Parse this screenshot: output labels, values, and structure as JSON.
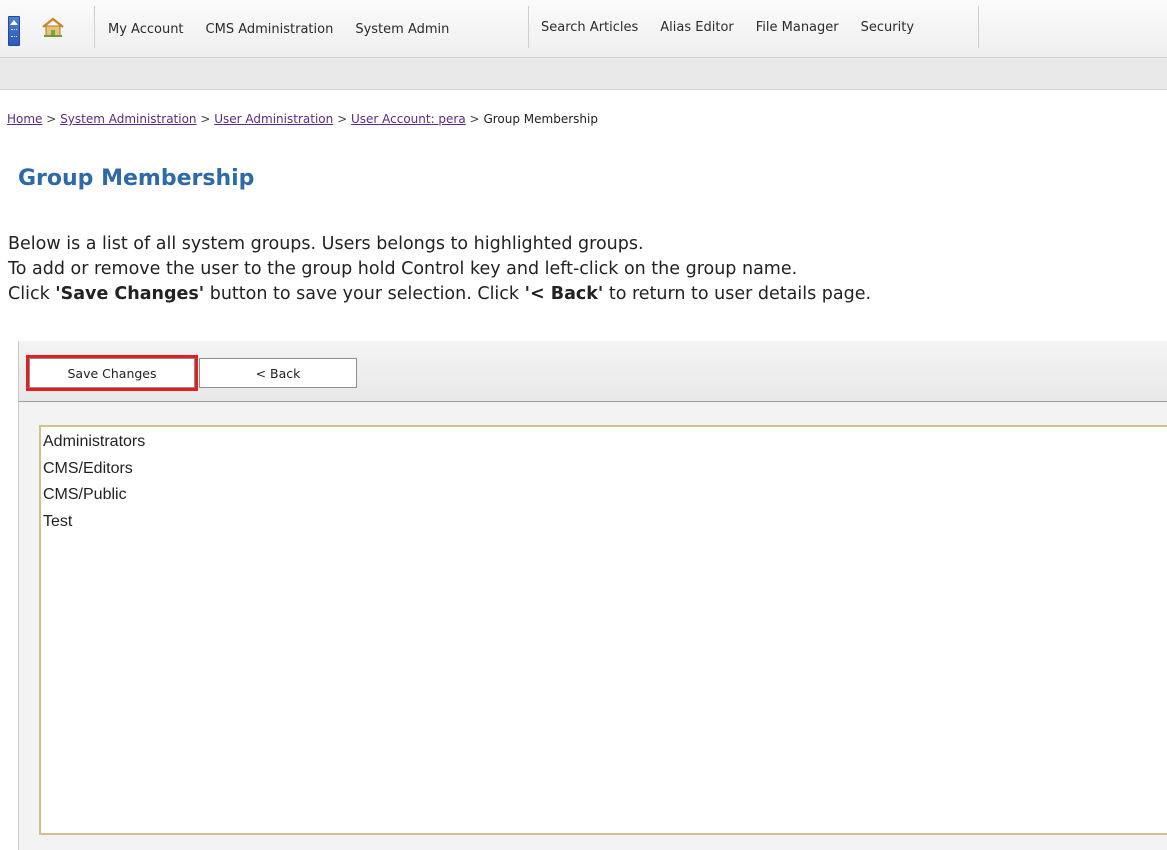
{
  "nav": {
    "collapse_icon": "collapse-up-arrow",
    "home_icon": "home-icon",
    "primary_items": [
      "My Account",
      "CMS Administration",
      "System Admin"
    ],
    "secondary_items": [
      "Search Articles",
      "Alias Editor",
      "File Manager",
      "Security"
    ]
  },
  "breadcrumb": {
    "items": [
      {
        "label": "Home",
        "link": true
      },
      {
        "label": "System Administration",
        "link": true
      },
      {
        "label": "User Administration",
        "link": true
      },
      {
        "label": "User Account: pera",
        "link": true
      },
      {
        "label": "Group Membership",
        "link": false
      }
    ],
    "separator": ">"
  },
  "page": {
    "title": "Group Membership",
    "line1": "Below is a list of all system groups. Users belongs to highlighted groups.",
    "line2": "To add or remove the user to the group hold Control key and left-click on the group name.",
    "line3_a": "Click ",
    "line3_b": "'Save Changes'",
    "line3_c": " button to save your selection. Click ",
    "line3_d": "'< Back'",
    "line3_e": " to return to user details page."
  },
  "toolbar": {
    "save_label": "Save Changes",
    "back_label": "< Back"
  },
  "groups": [
    "Administrators",
    "CMS/Editors",
    "CMS/Public",
    "Test"
  ],
  "colors": {
    "title": "#2f6aa8",
    "link": "#5a2a8a",
    "highlight_outline": "#e02020",
    "listbox_border": "#d6c08a"
  }
}
